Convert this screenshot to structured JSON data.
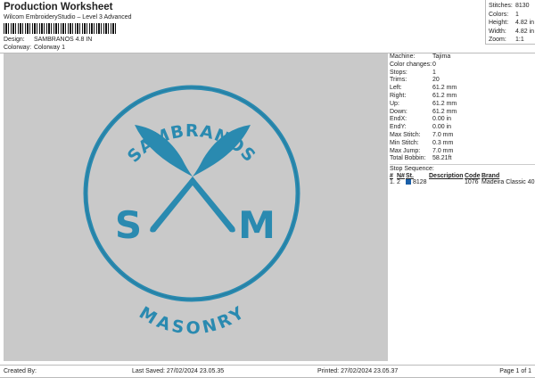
{
  "header": {
    "title": "Production Worksheet",
    "subtitle": "Wilcom EmbroideryStudio – Level 3 Advanced",
    "design_label": "Design:",
    "design_value": "SAMBRANOS 4.8 IN",
    "colorway_label": "Colorway:",
    "colorway_value": "Colorway 1"
  },
  "stats": [
    {
      "label": "Stitches:",
      "value": "8130"
    },
    {
      "label": "Colors:",
      "value": "1"
    },
    {
      "label": "Height:",
      "value": "4.82 in"
    },
    {
      "label": "Width:",
      "value": "4.82 in"
    },
    {
      "label": "Zoom:",
      "value": "1:1"
    }
  ],
  "properties": [
    {
      "label": "Machine:",
      "value": "Tajima"
    },
    {
      "label": "Color changes:",
      "value": "0"
    },
    {
      "label": "Stops:",
      "value": "1"
    },
    {
      "label": "Trims:",
      "value": "20"
    },
    {
      "label": "Left:",
      "value": "61.2 mm"
    },
    {
      "label": "Right:",
      "value": "61.2 mm"
    },
    {
      "label": "Up:",
      "value": "61.2 mm"
    },
    {
      "label": "Down:",
      "value": "61.2 mm"
    },
    {
      "label": "EndX:",
      "value": "0.00 in"
    },
    {
      "label": "EndY:",
      "value": "0.00 in"
    },
    {
      "label": "Max Stitch:",
      "value": "7.0 mm"
    },
    {
      "label": "Min Stitch:",
      "value": "0.3 mm"
    },
    {
      "label": "Max Jump:",
      "value": "7.0 mm"
    },
    {
      "label": "Total Bobbin:",
      "value": "58.21ft"
    }
  ],
  "stop_sequence": {
    "title": "Stop Sequence:",
    "columns": [
      "#",
      "N#",
      "St.",
      "Description",
      "Code",
      "Brand"
    ],
    "rows": [
      {
        "num": "1.",
        "n": "2",
        "color": "#1a5fa8",
        "st": "8128",
        "description": "",
        "code": "1076",
        "brand": "Madeira Classic 40"
      }
    ]
  },
  "design": {
    "thread_color": "#2a8ab0",
    "background": "#c9c9c9",
    "top_text": "SAMBRANOS",
    "bottom_text": "MASONRY",
    "left_letter": "S",
    "right_letter": "M"
  },
  "footer": {
    "created_by": "Created By:",
    "last_saved": "Last Saved: 27/02/2024 23.05.35",
    "printed": "Printed: 27/02/2024 23.05.37",
    "page": "Page 1 of 1"
  }
}
